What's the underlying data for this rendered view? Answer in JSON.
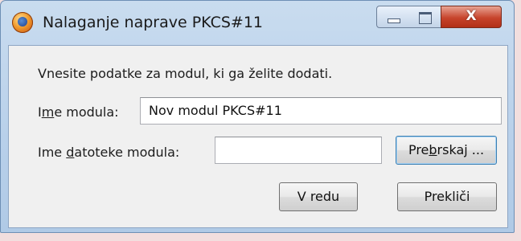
{
  "window": {
    "title": "Nalaganje naprave PKCS#11",
    "controls": {
      "minimize": "minimize",
      "maximize": "maximize",
      "close": "X"
    }
  },
  "form": {
    "intro": "Vnesite podatke za modul, ki ga želite dodati.",
    "module_name": {
      "label_pre": "I",
      "label_accel": "m",
      "label_post": "e modula:",
      "value": "Nov modul PKCS#11"
    },
    "module_file": {
      "label_pre": "Ime ",
      "label_accel": "d",
      "label_post": "atoteke modula:",
      "value": ""
    },
    "browse": {
      "pre": "Pre",
      "accel": "b",
      "post": "rskaj ..."
    }
  },
  "buttons": {
    "ok": "V redu",
    "cancel": "Prekliči"
  },
  "colors": {
    "titlebar": "#c9dcef",
    "client": "#f0f0f0",
    "close": "#c7442c"
  }
}
